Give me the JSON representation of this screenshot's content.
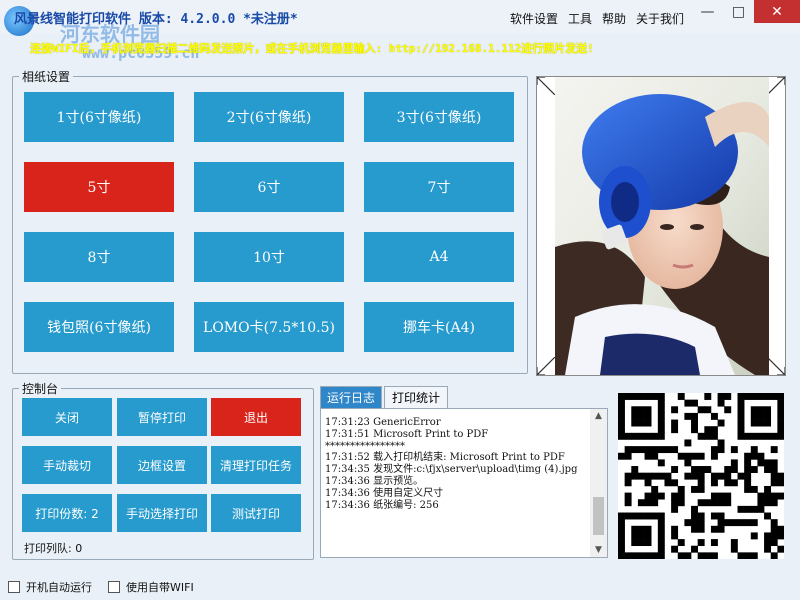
{
  "app": {
    "title": "风景线智能打印软件  版本: 4.2.0.0 *未注册*",
    "watermark": "河东软件园",
    "watermark_url": "www.pc0359.cn",
    "notice": "连接WIFI后，手机浏览器扫描二维码发送照片，或在手机浏览器里输入: http://192.168.1.112进行照片发送!"
  },
  "menu": {
    "items": [
      "软件设置",
      "工具",
      "帮助",
      "关于我们"
    ]
  },
  "window_controls": {
    "minimize": "—",
    "maximize": "□",
    "close": "✕"
  },
  "paper_settings": {
    "legend": "相纸设置",
    "buttons": [
      {
        "label": "1寸(6寸像纸)",
        "selected": false
      },
      {
        "label": "2寸(6寸像纸)",
        "selected": false
      },
      {
        "label": "3寸(6寸像纸)",
        "selected": false
      },
      {
        "label": "5寸",
        "selected": true
      },
      {
        "label": "6寸",
        "selected": false
      },
      {
        "label": "7寸",
        "selected": false
      },
      {
        "label": "8寸",
        "selected": false
      },
      {
        "label": "10寸",
        "selected": false
      },
      {
        "label": "A4",
        "selected": false
      },
      {
        "label": "钱包照(6寸像纸)",
        "selected": false
      },
      {
        "label": "LOMO卡(7.5*10.5)",
        "selected": false
      },
      {
        "label": "挪车卡(A4)",
        "selected": false
      }
    ]
  },
  "console": {
    "legend": "控制台",
    "buttons": [
      {
        "label": "关闭",
        "danger": false
      },
      {
        "label": "暂停打印",
        "danger": false
      },
      {
        "label": "退出",
        "danger": true
      },
      {
        "label": "手动裁切",
        "danger": false
      },
      {
        "label": "边框设置",
        "danger": false
      },
      {
        "label": "清理打印任务",
        "danger": false
      },
      {
        "label": "打印份数: 2",
        "danger": false
      },
      {
        "label": "手动选择打印",
        "danger": false
      },
      {
        "label": "测试打印",
        "danger": false
      }
    ],
    "queue_label": "打印列队: 0"
  },
  "log": {
    "tabs": [
      "运行日志",
      "打印统计"
    ],
    "active_tab": 0,
    "lines": [
      "17:31:23 GenericError",
      "17:31:51 Microsoft Print to PDF",
      "****************",
      "17:31:52 载入打印机结束: Microsoft Print to PDF",
      "17:34:35 发现文件:c:\\fjx\\server\\upload\\timg (4).jpg",
      "17:34:36 显示预览。",
      "17:34:36 使用自定义尺寸",
      "17:34:36 纸张编号: 256"
    ]
  },
  "footer": {
    "autostart": "开机自动运行",
    "wifi": "使用自带WIFI"
  },
  "colors": {
    "accent": "#279bce",
    "danger": "#d9241c",
    "notice": "#ffff00",
    "title": "#1a4aa8"
  }
}
